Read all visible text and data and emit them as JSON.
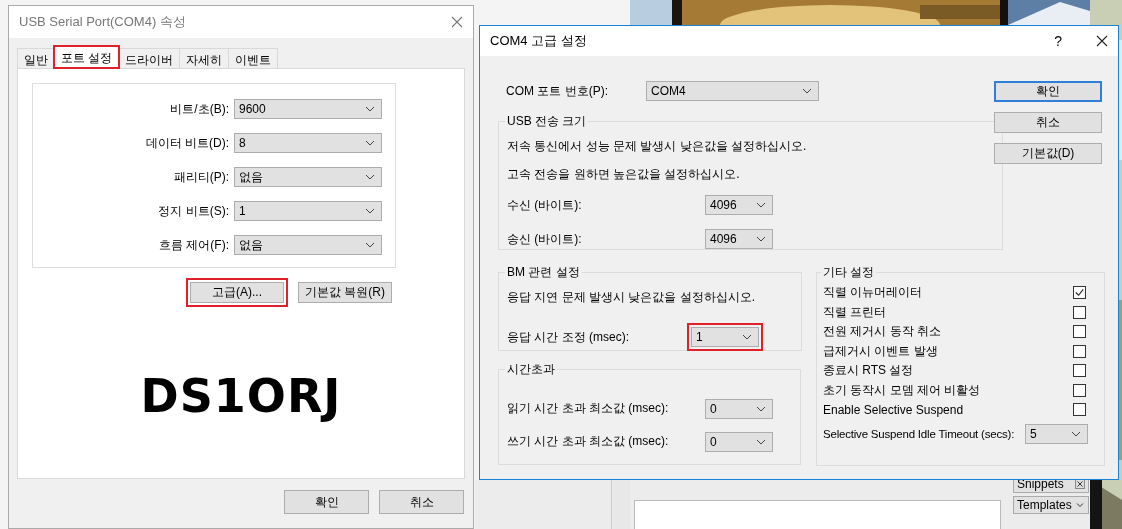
{
  "properties_dialog": {
    "title": "USB Serial Port(COM4) 속성",
    "tabs": [
      {
        "label": "일반",
        "selected": false,
        "highlighted": false
      },
      {
        "label": "포트 설정",
        "selected": true,
        "highlighted": true
      },
      {
        "label": "드라이버",
        "selected": false,
        "highlighted": false
      },
      {
        "label": "자세히",
        "selected": false,
        "highlighted": false
      },
      {
        "label": "이벤트",
        "selected": false,
        "highlighted": false
      }
    ],
    "fields": [
      {
        "label": "비트/초(B):",
        "value": "9600"
      },
      {
        "label": "데이터 비트(D):",
        "value": "8"
      },
      {
        "label": "패리티(P):",
        "value": "없음"
      },
      {
        "label": "정지 비트(S):",
        "value": "1"
      },
      {
        "label": "흐름 제어(F):",
        "value": "없음"
      }
    ],
    "buttons": [
      {
        "label": "고급(A)...",
        "highlighted": true
      },
      {
        "label": "기본값 복원(R)",
        "highlighted": false
      }
    ],
    "overlay_text": "DS1ORJ",
    "footer_buttons": [
      "확인",
      "취소"
    ]
  },
  "advanced_dialog": {
    "title": "COM4 고급 설정",
    "help": "?",
    "port_label": "COM 포트 번호(P):",
    "port_value": "COM4",
    "buttons": [
      {
        "label": "확인",
        "focused": true
      },
      {
        "label": "취소",
        "focused": false
      },
      {
        "label": "기본값(D)",
        "focused": false
      }
    ],
    "usb_group": {
      "title": "USB 전송 크기",
      "notes": [
        "저속 통신에서 성능 문제 발생시 낮은값을 설정하십시오.",
        "고속 전송을 원하면 높은값을 설정하십시오."
      ],
      "fields": [
        {
          "label": "수신 (바이트):",
          "value": "4096"
        },
        {
          "label": "송신 (바이트):",
          "value": "4096"
        }
      ]
    },
    "bm_group": {
      "title": "BM 관련 설정",
      "note": "응답 지연 문제 발생시 낮은값을 설정하십시오.",
      "field": {
        "label": "응답 시간 조정 (msec):",
        "value": "1",
        "highlighted": true
      }
    },
    "timeout_group": {
      "title": "시간초과",
      "fields": [
        {
          "label": "읽기 시간 초과 최소값 (msec):",
          "value": "0"
        },
        {
          "label": "쓰기 시간 초과 최소값 (msec):",
          "value": "0"
        }
      ]
    },
    "misc_group": {
      "title": "기타 설정",
      "options": [
        {
          "label": "직렬 이뉴머레이터",
          "checked": true
        },
        {
          "label": "직렬 프린터",
          "checked": false
        },
        {
          "label": "전원 제거시 동작 취소",
          "checked": false
        },
        {
          "label": "급제거시 이벤트 발생",
          "checked": false
        },
        {
          "label": "종료시 RTS 설정",
          "checked": false
        },
        {
          "label": "초기 동작시 모뎀 제어 비활성",
          "checked": false
        },
        {
          "label": "Enable Selective Suspend",
          "checked": false
        }
      ],
      "timeout_field": {
        "label": "Selective Suspend Idle Timeout (secs):",
        "value": "5"
      }
    }
  },
  "background_panels": [
    {
      "label": "Snippets",
      "kind": "close"
    },
    {
      "label": "Templates",
      "kind": "dropdown"
    }
  ]
}
